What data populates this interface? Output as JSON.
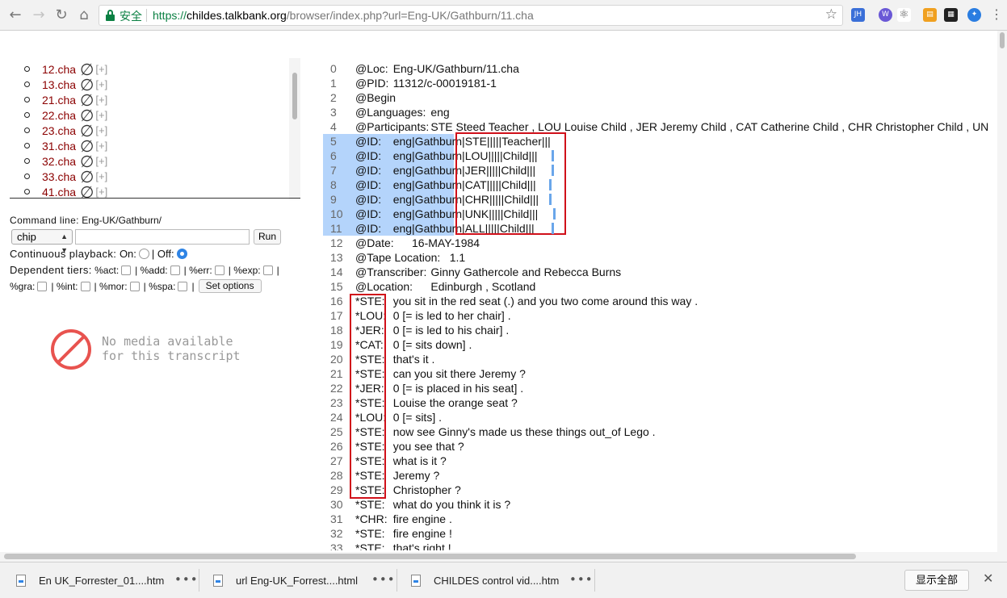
{
  "browser": {
    "secure_label": "安全",
    "url_scheme": "https://",
    "url_host": "childes.talkbank.org",
    "url_path": "/browser/index.php?url=Eng-UK/Gathburn/11.cha",
    "ext_jh": "JH",
    "ext_badge": "W"
  },
  "file_list": [
    {
      "name": "12.cha",
      "null_symbol": "∅",
      "expand": "[+]"
    },
    {
      "name": "13.cha",
      "null_symbol": "∅",
      "expand": "[+]"
    },
    {
      "name": "21.cha",
      "null_symbol": "∅",
      "expand": "[+]"
    },
    {
      "name": "22.cha",
      "null_symbol": "∅",
      "expand": "[+]"
    },
    {
      "name": "23.cha",
      "null_symbol": "∅",
      "expand": "[+]"
    },
    {
      "name": "31.cha",
      "null_symbol": "∅",
      "expand": "[+]"
    },
    {
      "name": "32.cha",
      "null_symbol": "∅",
      "expand": "[+]"
    },
    {
      "name": "33.cha",
      "null_symbol": "∅",
      "expand": "[+]"
    },
    {
      "name": "41.cha",
      "null_symbol": "∅",
      "expand": "[+]"
    }
  ],
  "command": {
    "label": "Command line:",
    "path": "Eng-UK/Gathburn/",
    "select_value": "chip",
    "input_value": "",
    "run_label": "Run"
  },
  "playback": {
    "label": "Continuous playback:",
    "on_label": "On:",
    "sep": "|",
    "off_label": "Off:",
    "selected": "off"
  },
  "tiers": {
    "label": "Dependent tiers:",
    "row1": [
      "%act:",
      "%add:",
      "%err:",
      "%exp:"
    ],
    "row2": [
      "%gra:",
      "%int:",
      "%mor:",
      "%spa:"
    ],
    "set_options_label": "Set options"
  },
  "no_media": {
    "line1": "No media available",
    "line2": "for this transcript"
  },
  "transcript": [
    {
      "n": "0",
      "text": "@Loc:\tEng-UK/Gathburn/11.cha"
    },
    {
      "n": "1",
      "text": "@PID:\t11312/c-00019181-1"
    },
    {
      "n": "2",
      "text": "@Begin"
    },
    {
      "n": "3",
      "text": "@Languages:\teng"
    },
    {
      "n": "4",
      "text": "@Participants:\tSTE Steed Teacher , LOU Louise Child , JER Jeremy Child , CAT Catherine Child , CHR Christopher Child , UN"
    },
    {
      "n": "5",
      "text": "@ID:\teng|Gathburn|STE|||||Teacher|||"
    },
    {
      "n": "6",
      "text": "@ID:\teng|Gathburn|LOU|||||Child|||"
    },
    {
      "n": "7",
      "text": "@ID:\teng|Gathburn|JER|||||Child|||"
    },
    {
      "n": "8",
      "text": "@ID:\teng|Gathburn|CAT|||||Child|||"
    },
    {
      "n": "9",
      "text": "@ID:\teng|Gathburn|CHR|||||Child|||"
    },
    {
      "n": "10",
      "text": "@ID:\teng|Gathburn|UNK|||||Child|||"
    },
    {
      "n": "11",
      "text": "@ID:\teng|Gathburn|ALL|||||Child|||"
    },
    {
      "n": "12",
      "text": "@Date:\t16-MAY-1984"
    },
    {
      "n": "13",
      "text": "@Tape Location:\t1.1"
    },
    {
      "n": "14",
      "text": "@Transcriber:\tGinny Gathercole and Rebecca Burns"
    },
    {
      "n": "15",
      "text": "@Location:\tEdinburgh , Scotland"
    },
    {
      "n": "16",
      "text": "*STE:\tyou sit in the red seat (.) and you two come around this way ."
    },
    {
      "n": "17",
      "text": "*LOU:\t0 [= is led to her chair] ."
    },
    {
      "n": "18",
      "text": "*JER:\t0 [= is led to his chair] ."
    },
    {
      "n": "19",
      "text": "*CAT:\t0 [= sits down] ."
    },
    {
      "n": "20",
      "text": "*STE:\tthat's it ."
    },
    {
      "n": "21",
      "text": "*STE:\tcan you sit there Jeremy ?"
    },
    {
      "n": "22",
      "text": "*JER:\t0 [= is placed in his seat] ."
    },
    {
      "n": "23",
      "text": "*STE:\tLouise the orange seat ?"
    },
    {
      "n": "24",
      "text": "*LOU:\t0 [= sits] ."
    },
    {
      "n": "25",
      "text": "*STE:\tnow see Ginny's made us these things out_of Lego ."
    },
    {
      "n": "26",
      "text": "*STE:\tyou see that ?"
    },
    {
      "n": "27",
      "text": "*STE:\twhat is it ?"
    },
    {
      "n": "28",
      "text": "*STE:\tJeremy ?"
    },
    {
      "n": "29",
      "text": "*STE:\tChristopher ?"
    },
    {
      "n": "30",
      "text": "*STE:\twhat do you think it is ?"
    },
    {
      "n": "31",
      "text": "*CHR:\tfire engine ."
    },
    {
      "n": "32",
      "text": "*STE:\tfire engine !"
    },
    {
      "n": "33",
      "text": "*STE:\tthat's right !"
    }
  ],
  "downloads": [
    {
      "name": "En UK_Forrester_01....htm"
    },
    {
      "name": "url Eng-UK_Forrest....html"
    },
    {
      "name": "CHILDES control vid....htm"
    }
  ],
  "download_more": "•••",
  "show_all_label": "显示全部",
  "colors": {
    "selection": "#b4d4fb",
    "highlight_box": "#d0101a",
    "file_link": "#8b0000",
    "secure_green": "#0b8043"
  }
}
